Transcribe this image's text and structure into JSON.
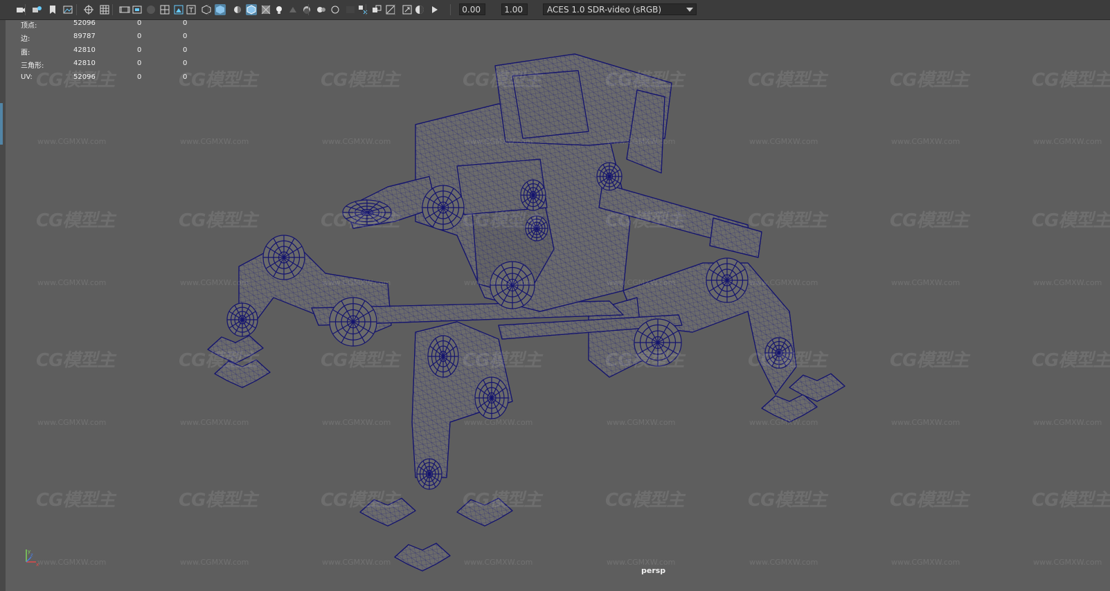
{
  "toolbar": {
    "icons": [
      "camera-icon",
      "camera-attributes-icon",
      "bookmark-icon",
      "image-plane-icon",
      "select-camera-icon",
      "grid-icon",
      "film-gate-icon",
      "resolution-gate-icon",
      "gate-mask-icon",
      "field-chart-icon",
      "safe-action-icon",
      "safe-title-icon",
      "wireframe-icon",
      "smooth-shade-icon",
      "default-material-icon",
      "wireframe-on-shaded-icon",
      "xray-icon",
      "use-all-lights-icon",
      "shadows-icon",
      "ambient-occlusion-icon",
      "motion-blur-icon",
      "antialiasing-icon",
      "depth-of-field-icon",
      "isolate-select-icon",
      "xray-active-icon",
      "xray-joints-icon",
      "exposure-icon",
      "gamma-icon",
      "color-management-icon"
    ],
    "exposure_value": "0.00",
    "gamma_value": "1.00",
    "color_space": "ACES 1.0 SDR-video (sRGB)"
  },
  "hud": {
    "rows": [
      {
        "label": "顶点:",
        "v1": "52096",
        "v2": "0",
        "v3": "0"
      },
      {
        "label": "边:",
        "v1": "89787",
        "v2": "0",
        "v3": "0"
      },
      {
        "label": "面:",
        "v1": "42810",
        "v2": "0",
        "v3": "0"
      },
      {
        "label": "三角形:",
        "v1": "42810",
        "v2": "0",
        "v3": "0"
      },
      {
        "label": "UV:",
        "v1": "52096",
        "v2": "0",
        "v3": "0"
      }
    ]
  },
  "watermark": {
    "logo": "CG模型主",
    "url": "www.CGMXW.com"
  },
  "camera_label": "persp",
  "axis": {
    "x": "x",
    "y": "y",
    "z": "z"
  },
  "colors": {
    "wire": "#14146e",
    "mesh_fill": "#6b6b6b",
    "viewport": "#5e5e5e",
    "toolbar": "#3c3c3c",
    "accent": "#5285a6"
  }
}
